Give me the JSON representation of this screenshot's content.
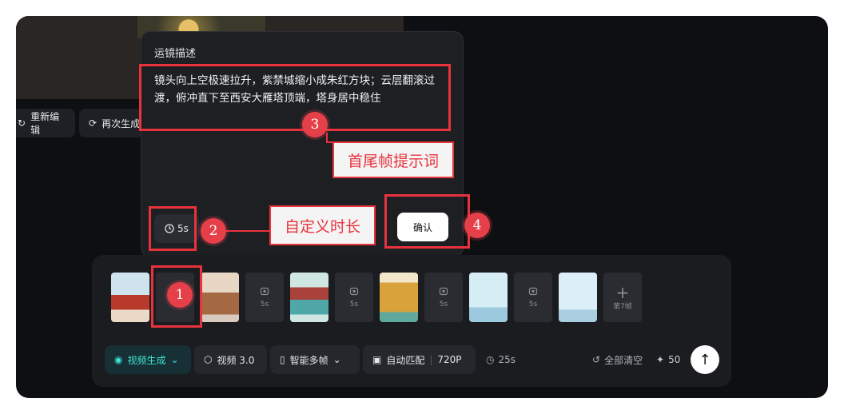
{
  "toolbar_left": {
    "reedit_label": "重新编辑",
    "regenerate_label": "再次生成"
  },
  "popup": {
    "title": "运镜描述",
    "prompt_line1": "镜头向上空极速拉升，紫禁城缩小成朱红方块；云层翻滚过",
    "prompt_line2": "渡，俯冲直下至西安大雁塔顶端，塔身居中稳住",
    "duration": "5s",
    "confirm_label": "确认"
  },
  "timeline": {
    "frames": [
      {
        "type": "image",
        "desc": "forbidden-city"
      },
      {
        "type": "slot",
        "duration": ""
      },
      {
        "type": "image",
        "desc": "pagoda"
      },
      {
        "type": "slot",
        "duration": "5s"
      },
      {
        "type": "image",
        "desc": "bridge-gate"
      },
      {
        "type": "slot",
        "duration": "5s"
      },
      {
        "type": "image",
        "desc": "yellow-crane-tower"
      },
      {
        "type": "slot",
        "duration": "5s"
      },
      {
        "type": "image",
        "desc": "tv-tower"
      },
      {
        "type": "slot",
        "duration": "5s"
      },
      {
        "type": "image",
        "desc": "canton-tower"
      }
    ],
    "add_label": "第7帧"
  },
  "bottom_toolbar": {
    "mode_label": "视频生成",
    "model_label": "视频 3.0",
    "multi_frame_label": "智能多帧",
    "ratio_label": "自动匹配",
    "resolution": "720P",
    "total_duration": "25s",
    "clear_label": "全部清空",
    "credits": "50"
  },
  "annotations": {
    "badge1": "1",
    "badge2": "2",
    "badge3": "3",
    "badge4": "4",
    "callout_prompt": "首尾帧提示词",
    "callout_duration": "自定义时长"
  },
  "colors": {
    "accent": "#3ee6d6",
    "annotation_red": "#e8333d",
    "app_bg": "#0e0f12"
  }
}
